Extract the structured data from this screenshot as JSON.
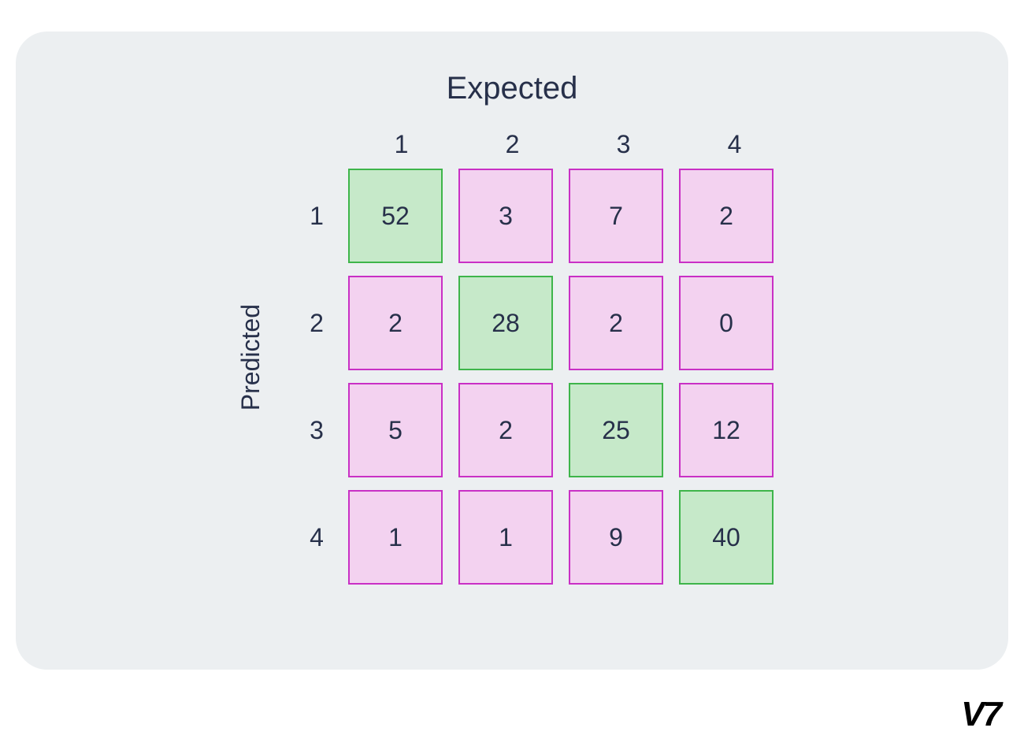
{
  "chart_data": {
    "type": "heatmap",
    "title": "Expected",
    "xlabel": "Expected",
    "ylabel": "Predicted",
    "x_categories": [
      "1",
      "2",
      "3",
      "4"
    ],
    "y_categories": [
      "1",
      "2",
      "3",
      "4"
    ],
    "matrix": [
      [
        52,
        3,
        7,
        2
      ],
      [
        2,
        28,
        2,
        0
      ],
      [
        5,
        2,
        25,
        12
      ],
      [
        1,
        1,
        9,
        40
      ]
    ],
    "diagonal_highlight": true
  },
  "colors": {
    "pink_fill": "#f3d2f0",
    "pink_border": "#c930c5",
    "green_fill": "#c6e9c9",
    "green_border": "#3eb54a",
    "text": "#27304a",
    "card_bg": "#eceff1"
  },
  "logo": "V7"
}
